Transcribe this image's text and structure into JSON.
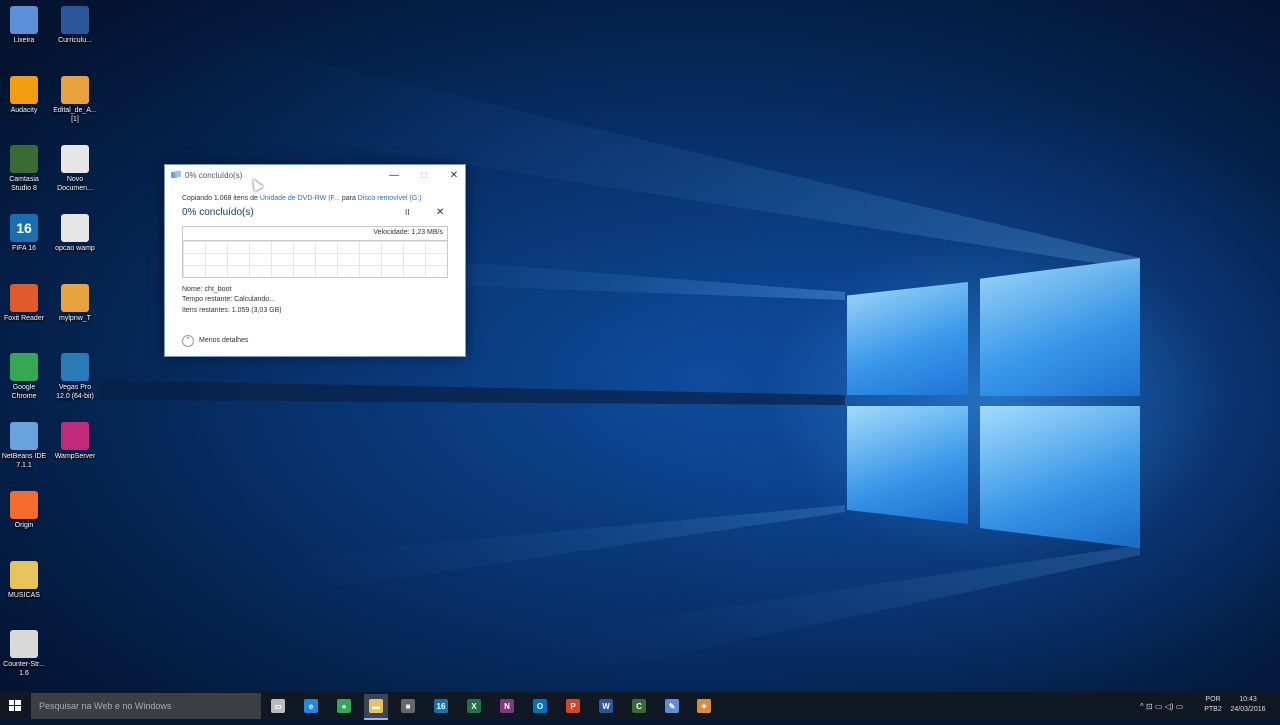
{
  "desktop_icons": [
    {
      "label": "Lixeira",
      "icon": "recycle-bin-icon",
      "color": "#5b8fd8"
    },
    {
      "label": "Curriculu...",
      "icon": "word-doc-icon",
      "color": "#2b579a"
    },
    {
      "label": "Audacity",
      "icon": "audacity-icon",
      "color": "#f39c12"
    },
    {
      "label": "Edital_de_A...\n[1]",
      "icon": "pdf-icon",
      "color": "#e8a33d"
    },
    {
      "label": "Camtasia\nStudio 8",
      "icon": "camtasia-icon",
      "color": "#3a6b35"
    },
    {
      "label": "Novo\nDocumen...",
      "icon": "text-file-icon",
      "color": "#e6e6e6"
    },
    {
      "label": "FIFA 16",
      "icon": "fifa-icon",
      "color": "#1a6fb0",
      "text": "16"
    },
    {
      "label": "opcao wamp",
      "icon": "text-file-icon",
      "color": "#e6e6e6"
    },
    {
      "label": "Foxit Reader",
      "icon": "foxit-icon",
      "color": "#e05a2b"
    },
    {
      "label": "mylpnw_T",
      "icon": "pdf-icon",
      "color": "#e8a33d"
    },
    {
      "label": "Google\nChrome",
      "icon": "chrome-icon",
      "color": "#34a853"
    },
    {
      "label": "Vegas Pro\n12.0 (64-bit)",
      "icon": "vegas-icon",
      "color": "#2a7ab8"
    },
    {
      "label": "NetBeans IDE\n7.1.1",
      "icon": "netbeans-icon",
      "color": "#6aa2dc"
    },
    {
      "label": "WampServer",
      "icon": "wamp-icon",
      "color": "#c2297a"
    },
    {
      "label": "Origin",
      "icon": "origin-icon",
      "color": "#f56c2d"
    },
    {
      "label": "MUSICAS",
      "icon": "folder-icon",
      "color": "#e8c25a"
    },
    {
      "label": "Counter-Str...\n1.6",
      "icon": "counter-strike-icon",
      "color": "#d9d9d9"
    }
  ],
  "dialog": {
    "title": "0% concluído(s)",
    "copy_prefix": "Copiando 1.068 itens de",
    "source": "Unidade de DVD-RW (F...",
    "copy_middle": "para",
    "destination": "Disco removível (G:)",
    "heading": "0% concluído(s)",
    "speed": "Velocidade: 1,23 MB/s",
    "progress": 0.0,
    "name_line": "Nome: cht_boot",
    "time_line": "Tempo restante: Calculando...",
    "items_line": "Itens restantes: 1.059 (3,03 GB)",
    "details_toggle": "Menos detalhes",
    "pause_glyph": "II",
    "cancel_glyph": "✕",
    "minimize_glyph": "—",
    "maximize_glyph": "□",
    "close_glyph": "✕"
  },
  "taskbar": {
    "search_placeholder": "Pesquisar na Web e no Windows",
    "apps": [
      {
        "icon": "task-view-icon",
        "color": "#bbbbbb",
        "text": "▭"
      },
      {
        "icon": "edge-icon",
        "color": "#1e88e5",
        "text": "e"
      },
      {
        "icon": "chrome-icon",
        "color": "#34a853",
        "text": "●"
      },
      {
        "icon": "file-explorer-icon",
        "color": "#e8c25a",
        "text": "▬"
      },
      {
        "icon": "store-icon",
        "color": "#666666",
        "text": "■"
      },
      {
        "icon": "fifa-icon",
        "color": "#1a6fb0",
        "text": "16"
      },
      {
        "icon": "excel-icon",
        "color": "#217346",
        "text": "X"
      },
      {
        "icon": "onenote-icon",
        "color": "#80397b",
        "text": "N"
      },
      {
        "icon": "outlook-icon",
        "color": "#0072c6",
        "text": "O"
      },
      {
        "icon": "powerpoint-icon",
        "color": "#d24726",
        "text": "P"
      },
      {
        "icon": "word-icon",
        "color": "#2b579a",
        "text": "W"
      },
      {
        "icon": "camtasia-icon",
        "color": "#3a6b35",
        "text": "C"
      },
      {
        "icon": "notepad-icon",
        "color": "#5b8fd8",
        "text": "✎"
      },
      {
        "icon": "paint-icon",
        "color": "#d98c3c",
        "text": "✦"
      }
    ],
    "tray_glyphs": "^  ⊡  ▭  ◁)  ▭",
    "lang_line1": "POR",
    "lang_line2": "PTB2",
    "time": "10:43",
    "date": "24/03/2016"
  }
}
